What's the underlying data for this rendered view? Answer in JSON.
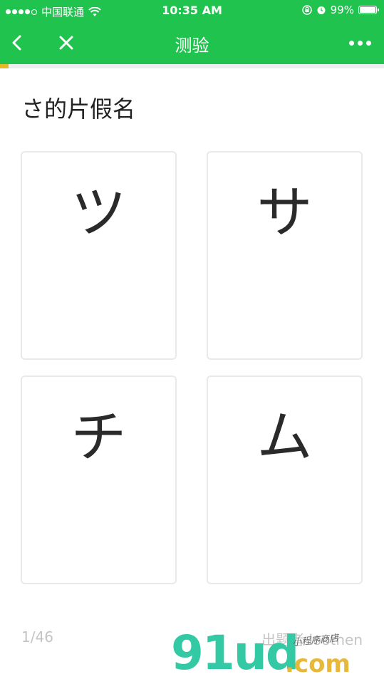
{
  "status_bar": {
    "carrier": "中国联通",
    "time": "10:35 AM",
    "battery": "99%",
    "battery_level": 0.99
  },
  "nav": {
    "title": "测验"
  },
  "progress": {
    "current": 1,
    "total": 46,
    "fraction": 0.0217
  },
  "question": {
    "text": "さ的片假名"
  },
  "options": [
    {
      "label": "ツ"
    },
    {
      "label": "サ"
    },
    {
      "label": "チ"
    },
    {
      "label": "ム"
    }
  ],
  "footer": {
    "counter": "1/46",
    "author": "出题者 loothen"
  },
  "watermark": {
    "main": "91ud",
    "domain": ".com",
    "sub": "小程序商店"
  },
  "colors": {
    "brand_green": "#1fc34e",
    "progress_yellow": "#e5b82a"
  }
}
